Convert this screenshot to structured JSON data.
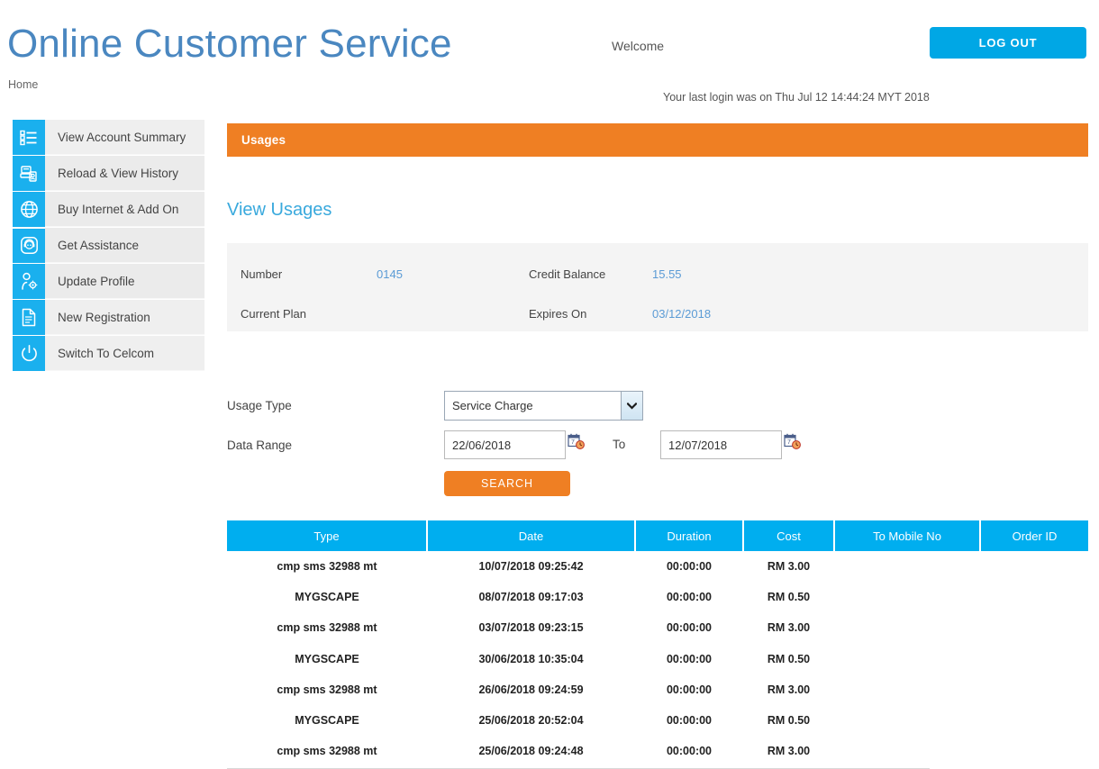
{
  "header": {
    "brand": "Online Customer Service",
    "breadcrumb": "Home",
    "welcome": "Welcome",
    "logout_label": "LOG OUT",
    "last_login": "Your last login was on Thu Jul 12 14:44:24 MYT 2018"
  },
  "sidebar": {
    "items": [
      {
        "label": "View Account Summary",
        "icon": "list-icon",
        "has_chevron": false
      },
      {
        "label": "Reload & View History",
        "icon": "device-reload-icon",
        "has_chevron": true
      },
      {
        "label": "Buy Internet & Add On",
        "icon": "globe-icon",
        "has_chevron": true
      },
      {
        "label": "Get Assistance",
        "icon": "headset-support-icon",
        "has_chevron": true
      },
      {
        "label": "Update Profile",
        "icon": "person-gear-icon",
        "has_chevron": true
      },
      {
        "label": "New Registration",
        "icon": "document-icon",
        "has_chevron": false
      },
      {
        "label": "Switch To Celcom",
        "icon": "power-icon",
        "has_chevron": false
      }
    ]
  },
  "main": {
    "panel_title": "Usages",
    "section_heading": "View Usages",
    "account": {
      "number_label": "Number",
      "number_value": "0145",
      "credit_balance_label": "Credit Balance",
      "credit_balance_value": "15.55",
      "current_plan_label": "Current Plan",
      "current_plan_value": "",
      "expires_on_label": "Expires On",
      "expires_on_value": "03/12/2018"
    },
    "form": {
      "usage_type_label": "Usage Type",
      "usage_type_value": "Service Charge",
      "usage_type_options": [
        "Service Charge"
      ],
      "data_range_label": "Data Range",
      "date_from": "22/06/2018",
      "date_to": "12/07/2018",
      "to_label": "To",
      "search_label": "SEARCH"
    },
    "table": {
      "columns": [
        "Type",
        "Date",
        "Duration",
        "Cost",
        "To Mobile No",
        "Order ID"
      ],
      "rows": [
        {
          "type": "cmp sms 32988 mt",
          "date": "10/07/2018 09:25:42",
          "duration": "00:00:00",
          "cost": "RM 3.00",
          "to_mobile_no": "",
          "order_id": ""
        },
        {
          "type": "MYGSCAPE",
          "date": "08/07/2018 09:17:03",
          "duration": "00:00:00",
          "cost": "RM 0.50",
          "to_mobile_no": "",
          "order_id": ""
        },
        {
          "type": "cmp sms 32988 mt",
          "date": "03/07/2018 09:23:15",
          "duration": "00:00:00",
          "cost": "RM 3.00",
          "to_mobile_no": "",
          "order_id": ""
        },
        {
          "type": "MYGSCAPE",
          "date": "30/06/2018 10:35:04",
          "duration": "00:00:00",
          "cost": "RM 0.50",
          "to_mobile_no": "",
          "order_id": ""
        },
        {
          "type": "cmp sms 32988 mt",
          "date": "26/06/2018 09:24:59",
          "duration": "00:00:00",
          "cost": "RM 3.00",
          "to_mobile_no": "",
          "order_id": ""
        },
        {
          "type": "MYGSCAPE",
          "date": "25/06/2018 20:52:04",
          "duration": "00:00:00",
          "cost": "RM 0.50",
          "to_mobile_no": "",
          "order_id": ""
        },
        {
          "type": "cmp sms 32988 mt",
          "date": "25/06/2018 09:24:48",
          "duration": "00:00:00",
          "cost": "RM 3.00",
          "to_mobile_no": "",
          "order_id": ""
        }
      ]
    }
  },
  "colors": {
    "brand_blue": "#4a87c0",
    "accent_cyan": "#00aeef",
    "sidebar_blue": "#1ab0ee",
    "orange": "#ef7f23",
    "value_blue": "#5b9bd5",
    "heading_blue": "#39a9dd"
  }
}
